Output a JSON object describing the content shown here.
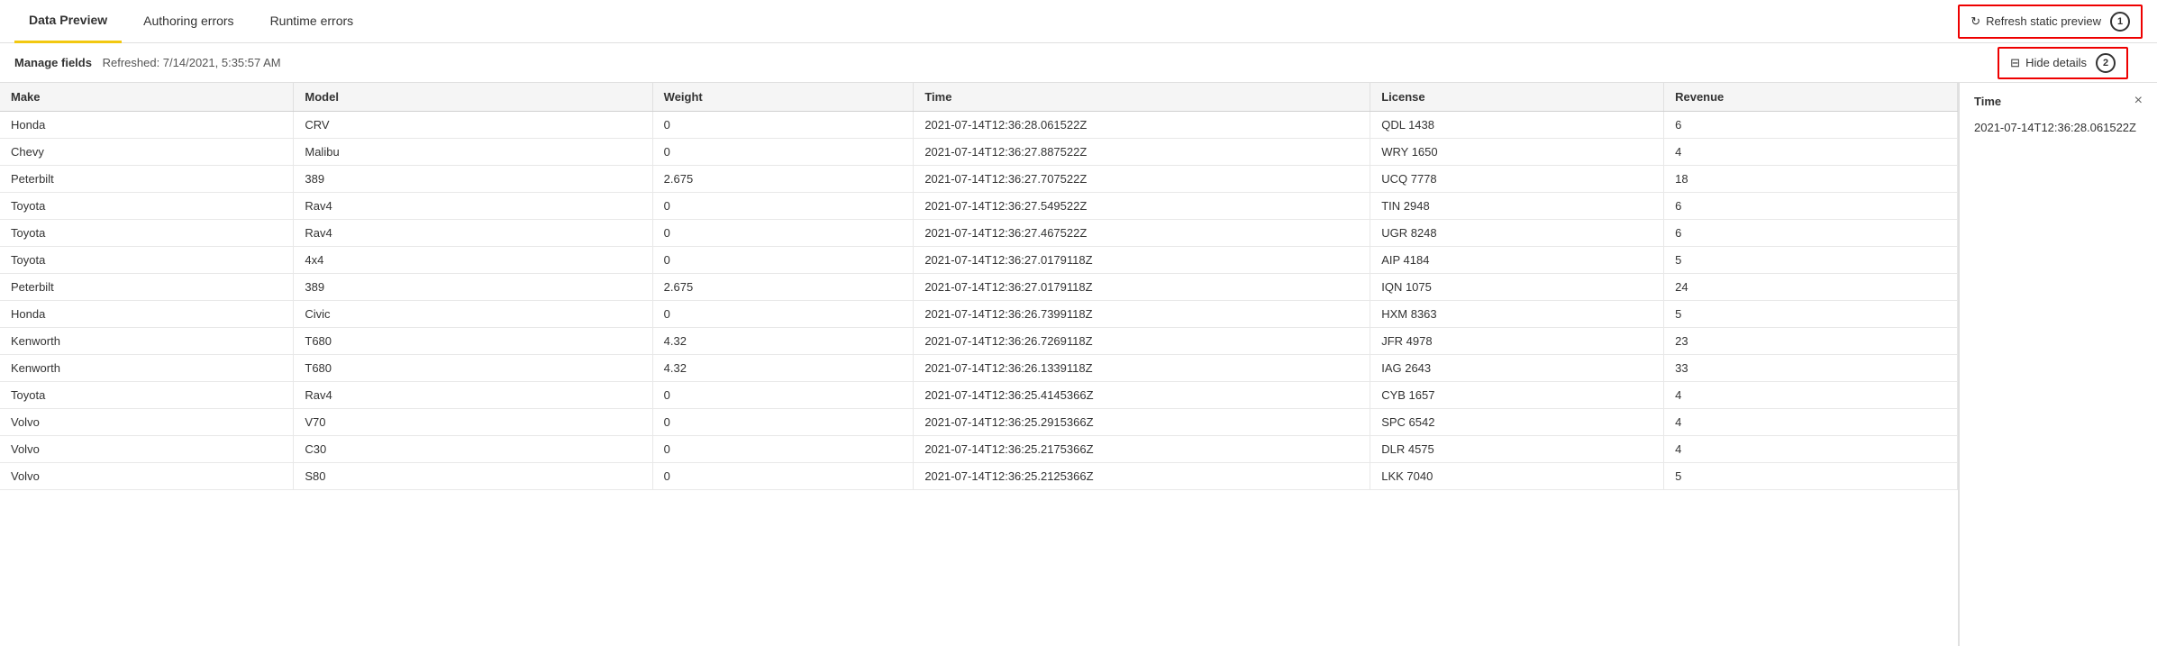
{
  "tabs": [
    {
      "id": "data-preview",
      "label": "Data Preview",
      "active": true
    },
    {
      "id": "authoring-errors",
      "label": "Authoring errors",
      "active": false
    },
    {
      "id": "runtime-errors",
      "label": "Runtime errors",
      "active": false
    }
  ],
  "refresh_btn": {
    "label": "Refresh static preview",
    "badge": "1"
  },
  "manage_bar": {
    "title": "Manage fields",
    "refreshed": "Refreshed: 7/14/2021, 5:35:57 AM",
    "hide_details_label": "Hide details",
    "hide_details_badge": "2"
  },
  "table": {
    "columns": [
      {
        "id": "make",
        "label": "Make"
      },
      {
        "id": "model",
        "label": "Model"
      },
      {
        "id": "weight",
        "label": "Weight"
      },
      {
        "id": "time",
        "label": "Time"
      },
      {
        "id": "license",
        "label": "License"
      },
      {
        "id": "revenue",
        "label": "Revenue"
      }
    ],
    "rows": [
      {
        "make": "Honda",
        "model": "CRV",
        "weight": "0",
        "time": "2021-07-14T12:36:28.061522Z",
        "license": "QDL 1438",
        "revenue": "6"
      },
      {
        "make": "Chevy",
        "model": "Malibu",
        "weight": "0",
        "time": "2021-07-14T12:36:27.887522Z",
        "license": "WRY 1650",
        "revenue": "4"
      },
      {
        "make": "Peterbilt",
        "model": "389",
        "weight": "2.675",
        "time": "2021-07-14T12:36:27.707522Z",
        "license": "UCQ 7778",
        "revenue": "18"
      },
      {
        "make": "Toyota",
        "model": "Rav4",
        "weight": "0",
        "time": "2021-07-14T12:36:27.549522Z",
        "license": "TIN 2948",
        "revenue": "6"
      },
      {
        "make": "Toyota",
        "model": "Rav4",
        "weight": "0",
        "time": "2021-07-14T12:36:27.467522Z",
        "license": "UGR 8248",
        "revenue": "6"
      },
      {
        "make": "Toyota",
        "model": "4x4",
        "weight": "0",
        "time": "2021-07-14T12:36:27.0179118Z",
        "license": "AIP 4184",
        "revenue": "5"
      },
      {
        "make": "Peterbilt",
        "model": "389",
        "weight": "2.675",
        "time": "2021-07-14T12:36:27.0179118Z",
        "license": "IQN 1075",
        "revenue": "24"
      },
      {
        "make": "Honda",
        "model": "Civic",
        "weight": "0",
        "time": "2021-07-14T12:36:26.7399118Z",
        "license": "HXM 8363",
        "revenue": "5"
      },
      {
        "make": "Kenworth",
        "model": "T680",
        "weight": "4.32",
        "time": "2021-07-14T12:36:26.7269118Z",
        "license": "JFR 4978",
        "revenue": "23"
      },
      {
        "make": "Kenworth",
        "model": "T680",
        "weight": "4.32",
        "time": "2021-07-14T12:36:26.1339118Z",
        "license": "IAG 2643",
        "revenue": "33"
      },
      {
        "make": "Toyota",
        "model": "Rav4",
        "weight": "0",
        "time": "2021-07-14T12:36:25.4145366Z",
        "license": "CYB 1657",
        "revenue": "4"
      },
      {
        "make": "Volvo",
        "model": "V70",
        "weight": "0",
        "time": "2021-07-14T12:36:25.2915366Z",
        "license": "SPC 6542",
        "revenue": "4"
      },
      {
        "make": "Volvo",
        "model": "C30",
        "weight": "0",
        "time": "2021-07-14T12:36:25.2175366Z",
        "license": "DLR 4575",
        "revenue": "4"
      },
      {
        "make": "Volvo",
        "model": "S80",
        "weight": "0",
        "time": "2021-07-14T12:36:25.2125366Z",
        "license": "LKK 7040",
        "revenue": "5"
      }
    ]
  },
  "detail_panel": {
    "title": "Time",
    "value": "2021-07-14T12:36:28.061522Z",
    "close_label": "×"
  }
}
